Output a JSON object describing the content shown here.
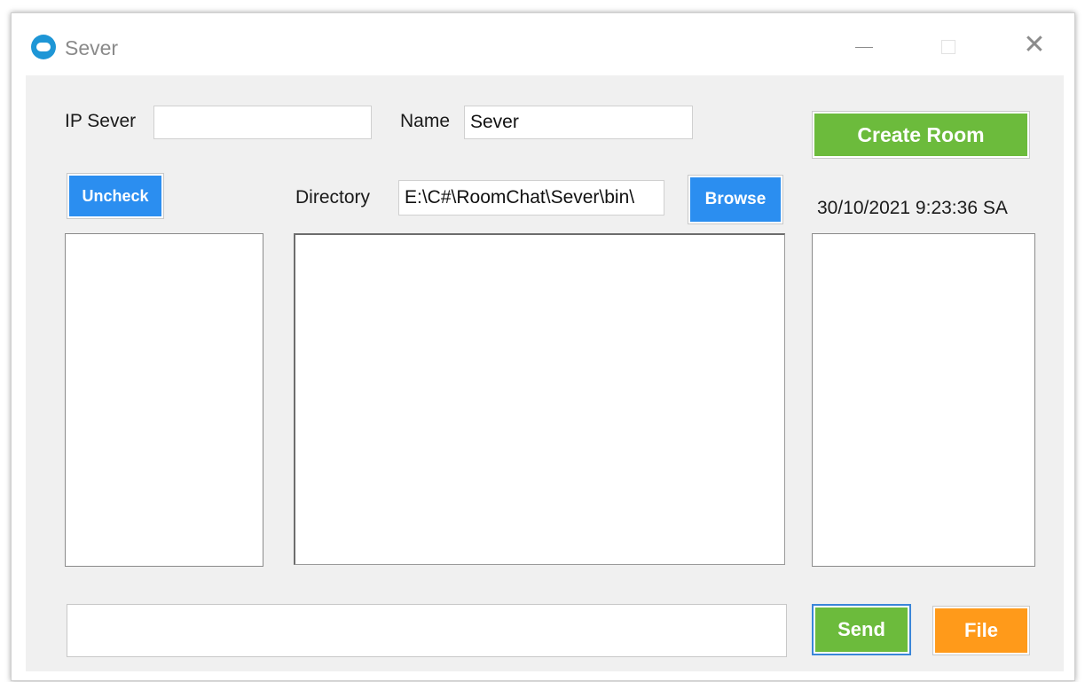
{
  "window": {
    "title": "Sever"
  },
  "form": {
    "ip_label": "IP Sever",
    "ip_value": "",
    "name_label": "Name",
    "name_value": "Sever",
    "create_room_label": "Create Room",
    "uncheck_label": "Uncheck",
    "directory_label": "Directory",
    "directory_value": "E:\\C#\\RoomChat\\Sever\\bin\\",
    "browse_label": "Browse",
    "timestamp": "30/10/2021 9:23:36 SA",
    "message_value": "",
    "send_label": "Send",
    "file_label": "File"
  },
  "colors": {
    "green": "#6cbb3c",
    "blue": "#2b8ef0",
    "orange": "#ff9a1a"
  },
  "icons": {
    "app": "chat-bubble-icon",
    "minimize": "minimize-icon",
    "maximize": "maximize-icon",
    "close": "close-icon"
  }
}
